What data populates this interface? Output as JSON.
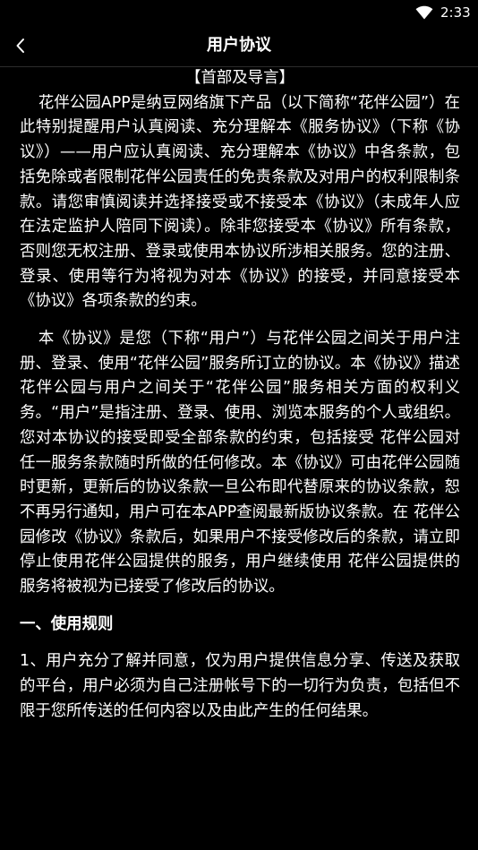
{
  "status_bar": {
    "time": "2:33",
    "wifi_icon": "wifi-icon"
  },
  "nav": {
    "back_icon": "chevron-left-icon",
    "title": "用户协议"
  },
  "colors": {
    "background": "#000000",
    "text": "#ffffff",
    "divider": "#2c2c2c"
  },
  "agreement": {
    "section_title": "【首部及导言】",
    "para1": "花伴公园APP是纳豆网络旗下产品（以下简称“花伴公园”）在此特别提醒用户认真阅读、充分理解本《服务协议》（下称《协议》）——用户应认真阅读、充分理解本《协议》中各条款，包括免除或者限制花伴公园责任的免责条款及对用户的权利限制条款。请您审慎阅读并选择接受或不接受本《协议》（未成年人应在法定监护人陪同下阅读）。除非您接受本《协议》所有条款，否则您无权注册、登录或使用本协议所涉相关服务。您的注册、登录、使用等行为将视为对本《协议》的接受，并同意接受本《协议》各项条款的约束。",
    "para2": "本《协议》是您（下称“用户”）与花伴公园之间关于用户注册、登录、使用“花伴公园”服务所订立的协议。本《协议》描述 花伴公园与用户之间关于“花伴公园”服务相关方面的权利义务。“用户”是指注册、登录、使用、浏览本服务的个人或组织。您对本协议的接受即受全部条款的约束，包括接受 花伴公园对任一服务条款随时所做的任何修改。本《协议》可由花伴公园随时更新，更新后的协议条款一旦公布即代替原来的协议条款，恕不再另行通知，用户可在本APP查阅最新版协议条款。在 花伴公园修改《协议》条款后，如果用户不接受修改后的条款，请立即停止使用花伴公园提供的服务，用户继续使用 花伴公园提供的服务将被视为已接受了修改后的协议。",
    "rules_heading": "一、使用规则",
    "rule1": "1、用户充分了解并同意，仅为用户提供信息分享、传送及获取的平台，用户必须为自己注册帐号下的一切行为负责，包括但不限于您所传送的任何内容以及由此产生的任何结果。"
  }
}
